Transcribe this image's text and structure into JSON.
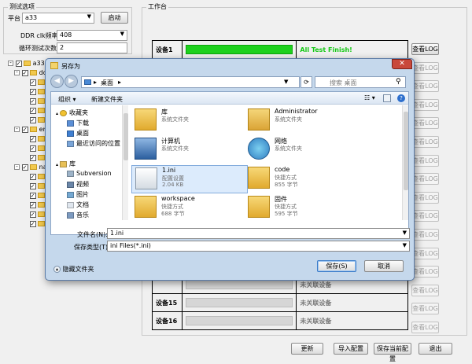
{
  "left_panel": {
    "group_title": "测试选项",
    "platform_label": "平台",
    "platform_value": "a33",
    "start_button": "启动",
    "ddr_label": "DDR clk频率",
    "ddr_value": "408",
    "loop_label": "循环测试次数",
    "loop_value": "2",
    "tree": [
      {
        "label": "a33",
        "level": 0,
        "expand": "-",
        "checked": true
      },
      {
        "label": "dd",
        "level": 1,
        "expand": "-",
        "checked": true
      },
      {
        "label": "",
        "level": 2,
        "checked": true
      },
      {
        "label": "",
        "level": 2,
        "checked": true
      },
      {
        "label": "",
        "level": 2,
        "checked": true
      },
      {
        "label": "",
        "level": 2,
        "checked": true
      },
      {
        "label": "",
        "level": 2,
        "checked": true
      },
      {
        "label": "em",
        "level": 1,
        "expand": "-",
        "checked": true
      },
      {
        "label": "",
        "level": 2,
        "checked": true
      },
      {
        "label": "",
        "level": 2,
        "checked": true
      },
      {
        "label": "",
        "level": 2,
        "checked": true
      },
      {
        "label": "na",
        "level": 1,
        "expand": "-",
        "checked": true
      },
      {
        "label": "",
        "level": 2,
        "checked": true
      },
      {
        "label": "",
        "level": 2,
        "checked": true
      },
      {
        "label": "",
        "level": 2,
        "checked": true
      },
      {
        "label": "",
        "level": 2,
        "checked": true
      },
      {
        "label": "",
        "level": 2,
        "checked": true
      },
      {
        "label": "",
        "level": 2,
        "checked": true
      }
    ]
  },
  "workspace": {
    "group_title": "工作台",
    "log_button": "查看LOG",
    "rows": [
      {
        "device": "设备1",
        "progress": 1.0,
        "status": "All Test Finish!",
        "status_color": "#14c814",
        "log_enabled": true
      },
      {
        "device": "",
        "progress": 0,
        "status": "",
        "log_enabled": false
      },
      {
        "device": "",
        "progress": 0,
        "status": "",
        "log_enabled": false
      },
      {
        "device": "",
        "progress": 0,
        "status": "",
        "log_enabled": false
      },
      {
        "device": "",
        "progress": 0,
        "status": "",
        "log_enabled": false
      },
      {
        "device": "",
        "progress": 0,
        "status": "",
        "log_enabled": false
      },
      {
        "device": "",
        "progress": 0,
        "status": "",
        "log_enabled": false
      },
      {
        "device": "",
        "progress": 0,
        "status": "",
        "log_enabled": false
      },
      {
        "device": "",
        "progress": 0,
        "status": "",
        "log_enabled": false
      },
      {
        "device": "",
        "progress": 0,
        "status": "",
        "log_enabled": false
      },
      {
        "device": "",
        "progress": 0,
        "status": "",
        "log_enabled": false
      },
      {
        "device": "",
        "progress": 0,
        "status": "",
        "log_enabled": false
      },
      {
        "device": "",
        "progress": 0,
        "status": "",
        "log_enabled": false
      },
      {
        "device": "",
        "progress": 0,
        "status": "未关联设备",
        "log_enabled": false
      },
      {
        "device": "设备15",
        "progress": 0,
        "status": "未关联设备",
        "log_enabled": false
      },
      {
        "device": "设备16",
        "progress": 0,
        "status": "未关联设备",
        "log_enabled": false
      }
    ]
  },
  "bottom_buttons": {
    "refresh": "更新",
    "import": "导入配置",
    "save": "保存当前配置",
    "exit": "退出"
  },
  "dialog": {
    "title": "另存为",
    "address": "桌面",
    "address_arrow": "▸",
    "search_placeholder": "搜索 桌面",
    "organize": "组织 ▾",
    "new_folder": "新建文件夹",
    "nav": [
      {
        "label": "收藏夹",
        "icon": "star-icon",
        "indent": 0,
        "expand": "▴"
      },
      {
        "label": "下载",
        "icon": "download-folder-icon",
        "indent": 1
      },
      {
        "label": "桌面",
        "icon": "desktop-icon",
        "indent": 1
      },
      {
        "label": "最近访问的位置",
        "icon": "recent-places-icon",
        "indent": 1
      },
      {
        "label": "",
        "icon": "",
        "indent": 0
      },
      {
        "label": "库",
        "icon": "library-icon",
        "indent": 0,
        "expand": "▴"
      },
      {
        "label": "Subversion",
        "icon": "subversion-icon",
        "indent": 1
      },
      {
        "label": "视频",
        "icon": "video-icon",
        "indent": 1
      },
      {
        "label": "图片",
        "icon": "picture-icon",
        "indent": 1
      },
      {
        "label": "文档",
        "icon": "document-icon",
        "indent": 1
      },
      {
        "label": "音乐",
        "icon": "music-icon",
        "indent": 1
      }
    ],
    "files": [
      {
        "name": "库",
        "line1": "系统文件夹",
        "line2": "",
        "icon": "library-folder-icon",
        "col": 0,
        "row": 0
      },
      {
        "name": "Administrator",
        "line1": "系统文件夹",
        "line2": "",
        "icon": "user-folder-icon",
        "col": 1,
        "row": 0
      },
      {
        "name": "计算机",
        "line1": "系统文件夹",
        "line2": "",
        "icon": "computer-icon",
        "col": 0,
        "row": 1
      },
      {
        "name": "网络",
        "line1": "系统文件夹",
        "line2": "",
        "icon": "network-icon",
        "col": 1,
        "row": 1
      },
      {
        "name": "1.ini",
        "line1": "配置设置",
        "line2": "2.04 KB",
        "icon": "ini-file-icon",
        "col": 0,
        "row": 2,
        "selected": true
      },
      {
        "name": "code",
        "line1": "快捷方式",
        "line2": "855 字节",
        "icon": "shortcut-folder-icon",
        "col": 1,
        "row": 2
      },
      {
        "name": "workspace",
        "line1": "快捷方式",
        "line2": "688 字节",
        "icon": "shortcut-folder-icon",
        "col": 0,
        "row": 3
      },
      {
        "name": "固件",
        "line1": "快捷方式",
        "line2": "595 字节",
        "icon": "shortcut-folder-icon",
        "col": 1,
        "row": 3
      }
    ],
    "filename_label": "文件名(N):",
    "filename_value": "1.ini",
    "filetype_label": "保存类型(T):",
    "filetype_value": "ini Files(*.ini)",
    "hide_folders": "隐藏文件夹",
    "save_button": "保存(S)",
    "cancel_button": "取消"
  }
}
